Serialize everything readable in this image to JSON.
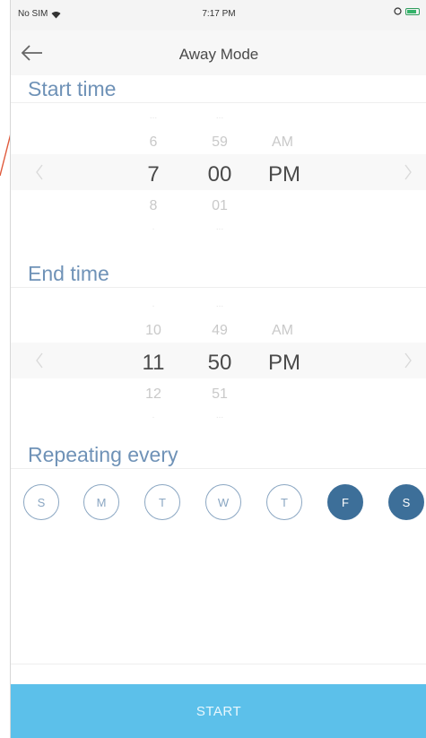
{
  "status_bar": {
    "carrier": "No SIM",
    "time": "7:17 PM",
    "battery": "56%"
  },
  "navbar": {
    "title": "Away Mode"
  },
  "start_time": {
    "label": "Start time",
    "hours": {
      "above": "6",
      "selected": "7",
      "below": "8"
    },
    "minutes": {
      "above": "59",
      "selected": "00",
      "below": "01"
    },
    "period": {
      "above": "AM",
      "selected": "PM"
    }
  },
  "end_time": {
    "label": "End time",
    "hours": {
      "above": "10",
      "selected": "11",
      "below": "12"
    },
    "minutes": {
      "above": "49",
      "selected": "50",
      "below": "51"
    },
    "period": {
      "above": "AM",
      "selected": "PM"
    }
  },
  "repeat": {
    "label": "Repeating every",
    "days": [
      {
        "letter": "S",
        "selected": false
      },
      {
        "letter": "M",
        "selected": false
      },
      {
        "letter": "T",
        "selected": false
      },
      {
        "letter": "W",
        "selected": false
      },
      {
        "letter": "T",
        "selected": false
      },
      {
        "letter": "F",
        "selected": true
      },
      {
        "letter": "S",
        "selected": true
      }
    ]
  },
  "start_button": {
    "label": "START"
  },
  "colors": {
    "accent": "#5cc0ea",
    "day_selected": "#3d6f99",
    "section_label": "#6f92b7"
  },
  "icons": {
    "back": "arrow-left-icon",
    "scroll_left": "chevron-left-icon",
    "scroll_right": "chevron-right-icon"
  }
}
